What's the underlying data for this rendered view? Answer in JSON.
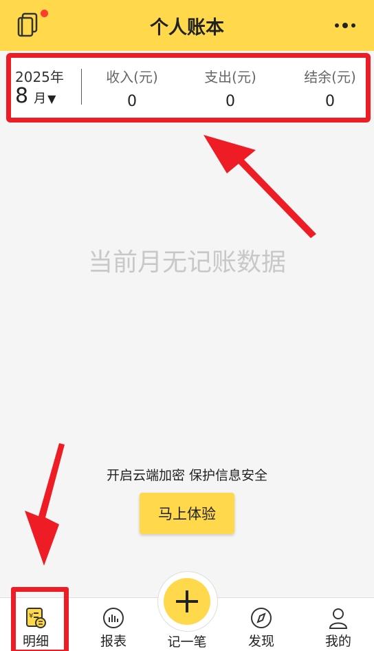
{
  "header": {
    "title": "个人账本",
    "left_icon": "book-icon",
    "right_icon": "more-icon",
    "notification_dot_color": "#ff3b30"
  },
  "summary": {
    "year": "2025年",
    "month": "8",
    "month_unit": "月",
    "month_arrow": "▼",
    "income_label": "收入(元)",
    "income_value": "0",
    "expense_label": "支出(元)",
    "expense_value": "0",
    "balance_label": "结余(元)",
    "balance_value": "0"
  },
  "empty_state": {
    "text": "当前月无记账数据"
  },
  "promo": {
    "text": "开启云端加密 保护信息安全",
    "button_label": "马上体验"
  },
  "bottom_nav": {
    "items": [
      {
        "label": "明细",
        "icon": "detail-icon",
        "active": true
      },
      {
        "label": "报表",
        "icon": "chart-icon"
      },
      {
        "label": "记一笔",
        "icon": "plus-icon"
      },
      {
        "label": "发现",
        "icon": "compass-icon"
      },
      {
        "label": "我的",
        "icon": "user-icon"
      }
    ]
  },
  "colors": {
    "accent": "#ffd84c",
    "annotation_red": "#ee1c25"
  }
}
